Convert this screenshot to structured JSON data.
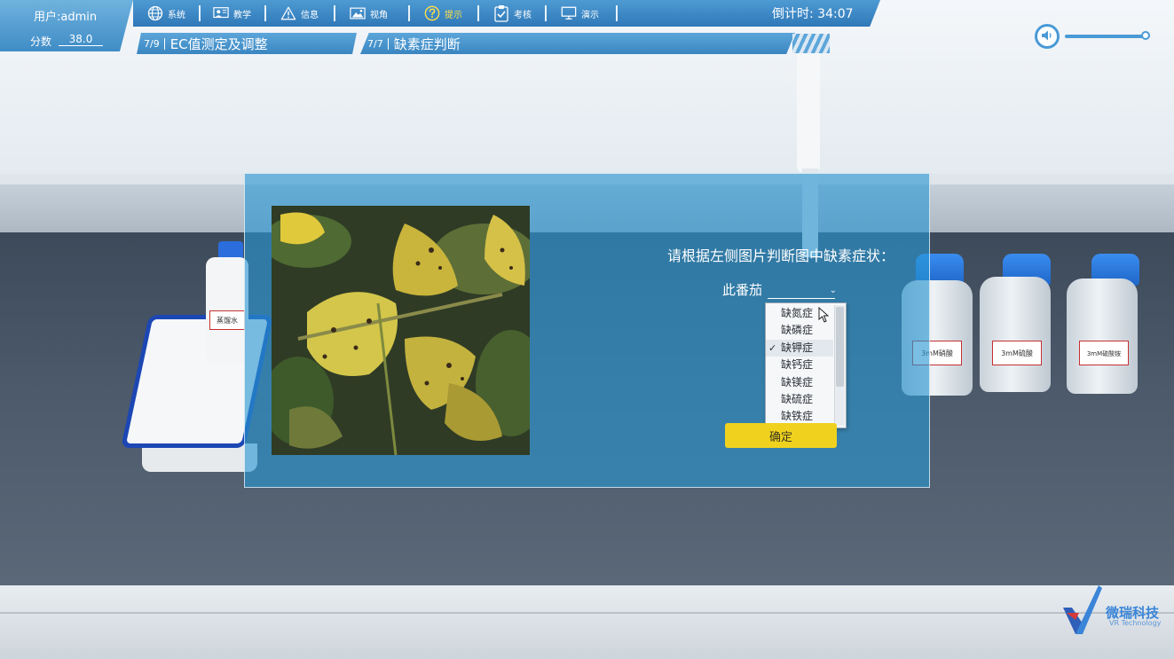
{
  "hud": {
    "user": "用户:admin",
    "score_label": "分数",
    "score_value": "38.0",
    "countdown": "倒计时: 34:07"
  },
  "menu": [
    {
      "label": "系统",
      "icon": "globe-icon"
    },
    {
      "label": "教学",
      "icon": "teaching-icon"
    },
    {
      "label": "信息",
      "icon": "warning-icon"
    },
    {
      "label": "视角",
      "icon": "image-icon"
    },
    {
      "label": "提示",
      "icon": "question-icon",
      "active": true
    },
    {
      "label": "考核",
      "icon": "clipboard-icon"
    },
    {
      "label": "演示",
      "icon": "monitor-icon"
    }
  ],
  "steps": [
    {
      "num": "7/9",
      "label": "EC值测定及调整"
    },
    {
      "num": "7/7",
      "label": "缺素症判断"
    }
  ],
  "dialog": {
    "question": "请根据左侧图片判断图中缺素症状：",
    "answer_prefix": "此番茄",
    "options": [
      "缺氮症",
      "缺磷症",
      "缺钾症",
      "缺钙症",
      "缺镁症",
      "缺硫症",
      "缺铁症"
    ],
    "selected_option": "缺钾症",
    "confirm_label": "确定"
  },
  "scene": {
    "labels": [
      "蒸馏水",
      "3mM硝酸",
      "3mM硫酸",
      "3mM硫酸铵"
    ]
  },
  "logo": {
    "name": "微瑞科技",
    "subtitle": "VR Technology"
  },
  "colors": {
    "hud_blue": "#3f8cc6",
    "active_menu": "#ffe14a",
    "dialog_bg": "#2896d2",
    "confirm_button": "#f0d21e"
  }
}
